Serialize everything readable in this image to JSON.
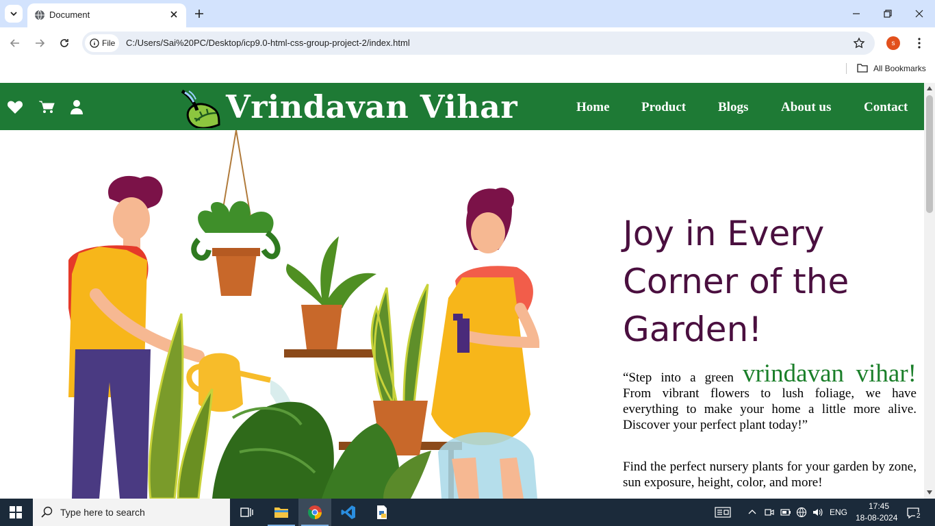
{
  "browser": {
    "tab_title": "Document",
    "address_chip": "File",
    "url": "C:/Users/Sai%20PC/Desktop/icp9.0-html-css-group-project-2/index.html",
    "profile_initial": "s",
    "bookmarks_label": "All Bookmarks"
  },
  "site": {
    "brand": "Vrindavan Vihar",
    "nav": [
      "Home",
      "Product",
      "Blogs",
      "About us",
      "Contact"
    ],
    "header_icons": [
      "heart-icon",
      "cart-icon",
      "user-icon"
    ],
    "colors": {
      "header_bg": "#1e7a35",
      "title": "#4a0f3f",
      "highlight": "#1b7f2a"
    }
  },
  "hero": {
    "title": "Joy in Every Corner of the Garden!",
    "quote_prefix": "“Step into a green",
    "quote_highlight": "vrindavan vihar!",
    "quote_rest": "From vibrant flowers to lush foliage, we have everything to make your home a little more alive. Discover your perfect plant today!”",
    "find_text": "Find the perfect nursery plants for your garden by zone, sun exposure, height, color, and more!"
  },
  "taskbar": {
    "search_placeholder": "Type here to search",
    "language": "ENG",
    "time": "17:45",
    "date": "18-08-2024",
    "notifications": "2"
  }
}
